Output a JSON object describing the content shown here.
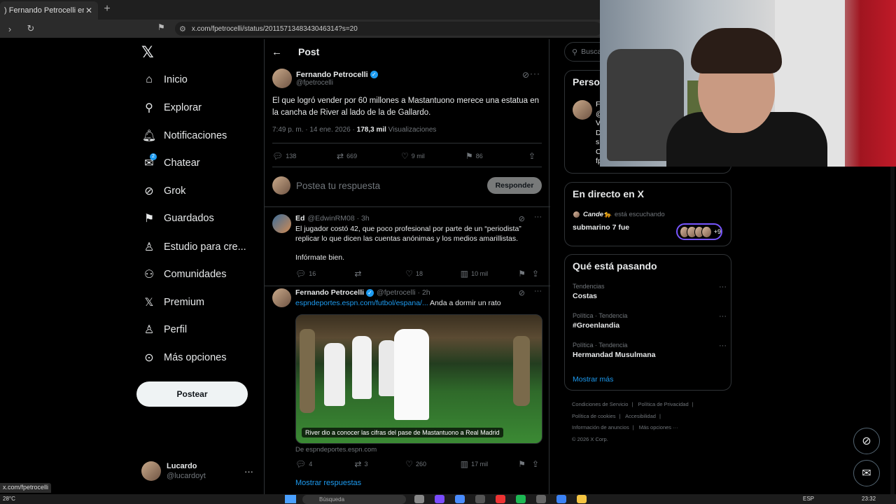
{
  "browser": {
    "tab_title": ") Fernando Petrocelli en X: \"El q",
    "tab_close": "✕",
    "new_tab": "+",
    "url": "x.com/fpetrocelli/status/2011571348343046314?s=20",
    "status_url": "x.com/fpetrocelli"
  },
  "nav": {
    "logo": "𝕏",
    "items": [
      {
        "label": "Inicio",
        "icon": "⌂",
        "name": "home-icon"
      },
      {
        "label": "Explorar",
        "icon": "⚲",
        "name": "search-icon"
      },
      {
        "label": "Notificaciones",
        "icon": "🔔︎",
        "name": "bell-icon"
      },
      {
        "label": "Chatear",
        "icon": "✉",
        "name": "mail-icon",
        "badge": "2"
      },
      {
        "label": "Grok",
        "icon": "⊘",
        "name": "grok-icon"
      },
      {
        "label": "Guardados",
        "icon": "⚑",
        "name": "bookmark-icon"
      },
      {
        "label": "Estudio para cre...",
        "icon": "♙",
        "name": "creator-studio-icon"
      },
      {
        "label": "Comunidades",
        "icon": "⚇",
        "name": "communities-icon"
      },
      {
        "label": "Premium",
        "icon": "𝕏",
        "name": "premium-icon"
      },
      {
        "label": "Perfil",
        "icon": "♙",
        "name": "profile-icon"
      },
      {
        "label": "Más opciones",
        "icon": "⊙",
        "name": "more-options-icon"
      }
    ],
    "post_button": "Postear",
    "account": {
      "name": "Lucardo",
      "handle": "@lucardoyt",
      "more": "···"
    }
  },
  "main": {
    "header_title": "Post",
    "tweet": {
      "author": "Fernando Petrocelli",
      "handle": "@fpetrocelli",
      "text": "El que logró vender por 60 millones a Mastantuono merece una estatua en la cancha de River al lado de la de Gallardo.",
      "time": "7:49 p. m. · 14 ene. 2026 · ",
      "views_count": "178,3 mil",
      "views_label": " Visualizaciones",
      "replies": "138",
      "reposts": "669",
      "likes": "9 mil",
      "bookmarks": "86"
    },
    "reply_box": {
      "placeholder": "Postea tu respuesta",
      "button": "Responder"
    },
    "replies": [
      {
        "author": "Ed",
        "handle": "@EdwinRM08 · 3h",
        "text1": "El jugador costó 42, que poco profesional por parte de un “periodista” replicar lo que dicen las cuentas anónimas y los medios amarillistas.",
        "text2": "Infórmate bien.",
        "replies": "16",
        "reposts": "",
        "likes": "18",
        "views": "10 mil"
      },
      {
        "author": "Fernando Petrocelli",
        "handle": "@fpetrocelli · 2h",
        "link": "espndeportes.espn.com/futbol/espana/...",
        "text_after": " Anda a dormir un rato",
        "media_caption": "River dio a conocer las cifras del pase de Mastantuono a Real Madrid",
        "source": "De espndeportes.espn.com",
        "replies": "4",
        "reposts": "3",
        "likes": "260",
        "views": "17 mil",
        "show_replies": "Mostrar respuestas"
      }
    ]
  },
  "right": {
    "search_placeholder": "Busca",
    "who_title": "Perso",
    "who_partial_lines": [
      "F",
      "@",
      "V",
      "D",
      "s",
      "C",
      "fp"
    ],
    "live": {
      "title": "En directo en X",
      "user": "Cande🐆",
      "listening": "está escuchando",
      "space": "submarino 7 fue",
      "extra": "+9"
    },
    "trends_title": "Qué está pasando",
    "trends": [
      {
        "context": "Tendencias",
        "name": "Costas"
      },
      {
        "context": "Política · Tendencia",
        "name": "#Groenlandia"
      },
      {
        "context": "Política · Tendencia",
        "name": "Hermandad Musulmana"
      }
    ],
    "show_more": "Mostrar más",
    "footer": [
      "Condiciones de Servicio",
      "|",
      "Política de Privacidad",
      "|",
      "Política de cookies",
      "|",
      "Accesibilidad",
      "|",
      "Información de anuncios",
      "|",
      "Más opciones ···",
      "© 2026 X Corp."
    ]
  },
  "taskbar": {
    "temp": "28°C",
    "search": "Búsqueda",
    "lang": "ESP",
    "time": "23:32"
  },
  "colors": {
    "accent": "#1d9bf0",
    "background": "#000000",
    "border": "#2f3336",
    "muted": "#71767b"
  }
}
